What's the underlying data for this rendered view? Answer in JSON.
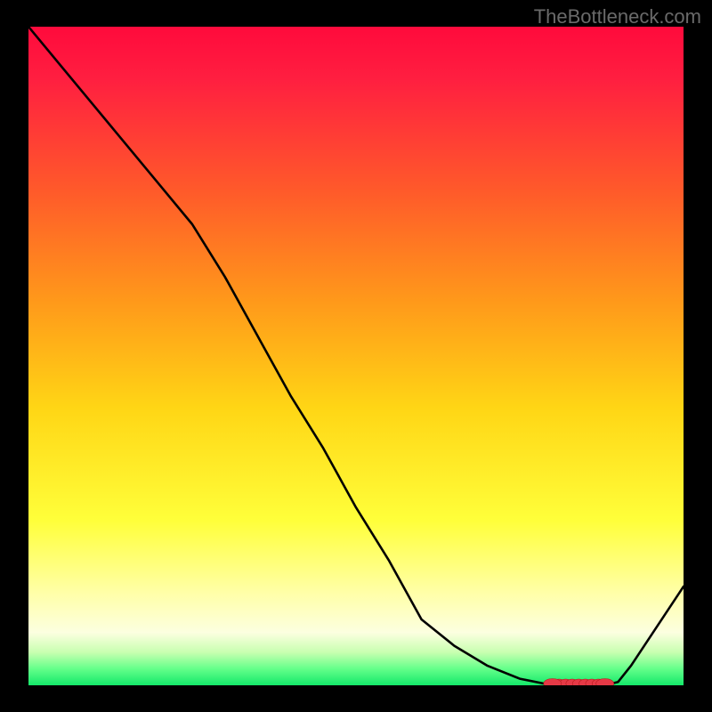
{
  "attribution": "TheBottleneck.com",
  "chart_data": {
    "type": "line",
    "title": "",
    "xlabel": "",
    "ylabel": "",
    "x": [
      0,
      5,
      10,
      15,
      20,
      25,
      30,
      35,
      40,
      45,
      50,
      55,
      60,
      65,
      70,
      75,
      80,
      82,
      84,
      85,
      86,
      87,
      88,
      90,
      92,
      100
    ],
    "y": [
      100,
      94,
      88,
      82,
      76,
      70,
      62,
      53,
      44,
      36,
      27,
      19,
      10,
      6,
      3,
      1,
      0,
      0,
      0,
      0,
      0,
      0,
      0,
      0.5,
      3,
      15
    ],
    "xlim": [
      0,
      100
    ],
    "ylim": [
      0,
      100
    ],
    "optimal_range": {
      "start": 80,
      "end": 88
    },
    "markers_x": [
      80,
      81,
      82,
      83,
      84,
      85,
      86,
      87,
      88
    ],
    "gradient": {
      "top": "#ff1744",
      "upper_mid": "#ff6d00",
      "mid": "#ffd600",
      "lower_mid": "#ffff8d",
      "bottom": "#00e676"
    }
  }
}
